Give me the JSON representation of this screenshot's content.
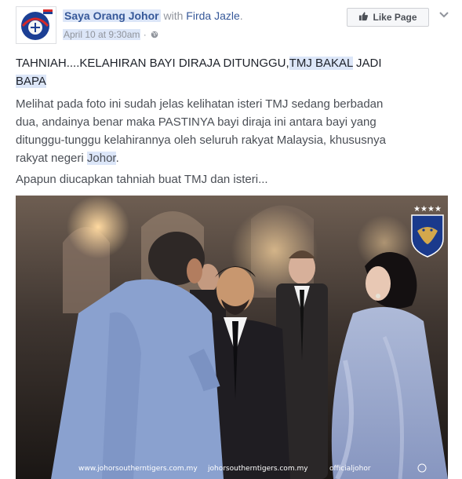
{
  "post": {
    "page_name": "Saya Orang Johor",
    "with_text": "with",
    "with_name": "Firda Jazle",
    "date": "April 10 at 9:30am",
    "separator": "·",
    "like_label": "Like Page",
    "headline": {
      "part1": "TAHNIAH....KELAHIRAN BAYI DIRAJA DITUNGGU,",
      "part2": "TMJ BAKAL",
      "part3": " JADI",
      "part4": "BAPA"
    },
    "para1": {
      "line1": "Melihat pada foto ini sudah jelas kelihatan isteri TMJ sedang berbadan",
      "line2": "dua, andainya benar maka PASTINYA bayi diraja ini antara bayi yang",
      "line3": "ditunggu-tunggu kelahirannya oleh seluruh rakyat Malaysia, khususnya",
      "line4a": "rakyat negeri ",
      "line4b": "Johor",
      "line4c": "."
    },
    "para2": "Apapun diucapkan tahniah buat TMJ dan isteri...",
    "photo": {
      "watermarks": [
        "www.johorsoutherntigers.com.my",
        "johorsoutherntigers.com.my",
        "officialjohor"
      ],
      "stars": "★★★★"
    }
  },
  "icons": [
    "page-avatar-logo",
    "globe-icon",
    "thumbs-up-icon",
    "chevron-down-icon"
  ],
  "colors": {
    "link": "#365899",
    "highlight": "#dce6f8",
    "muted": "#90949c"
  }
}
